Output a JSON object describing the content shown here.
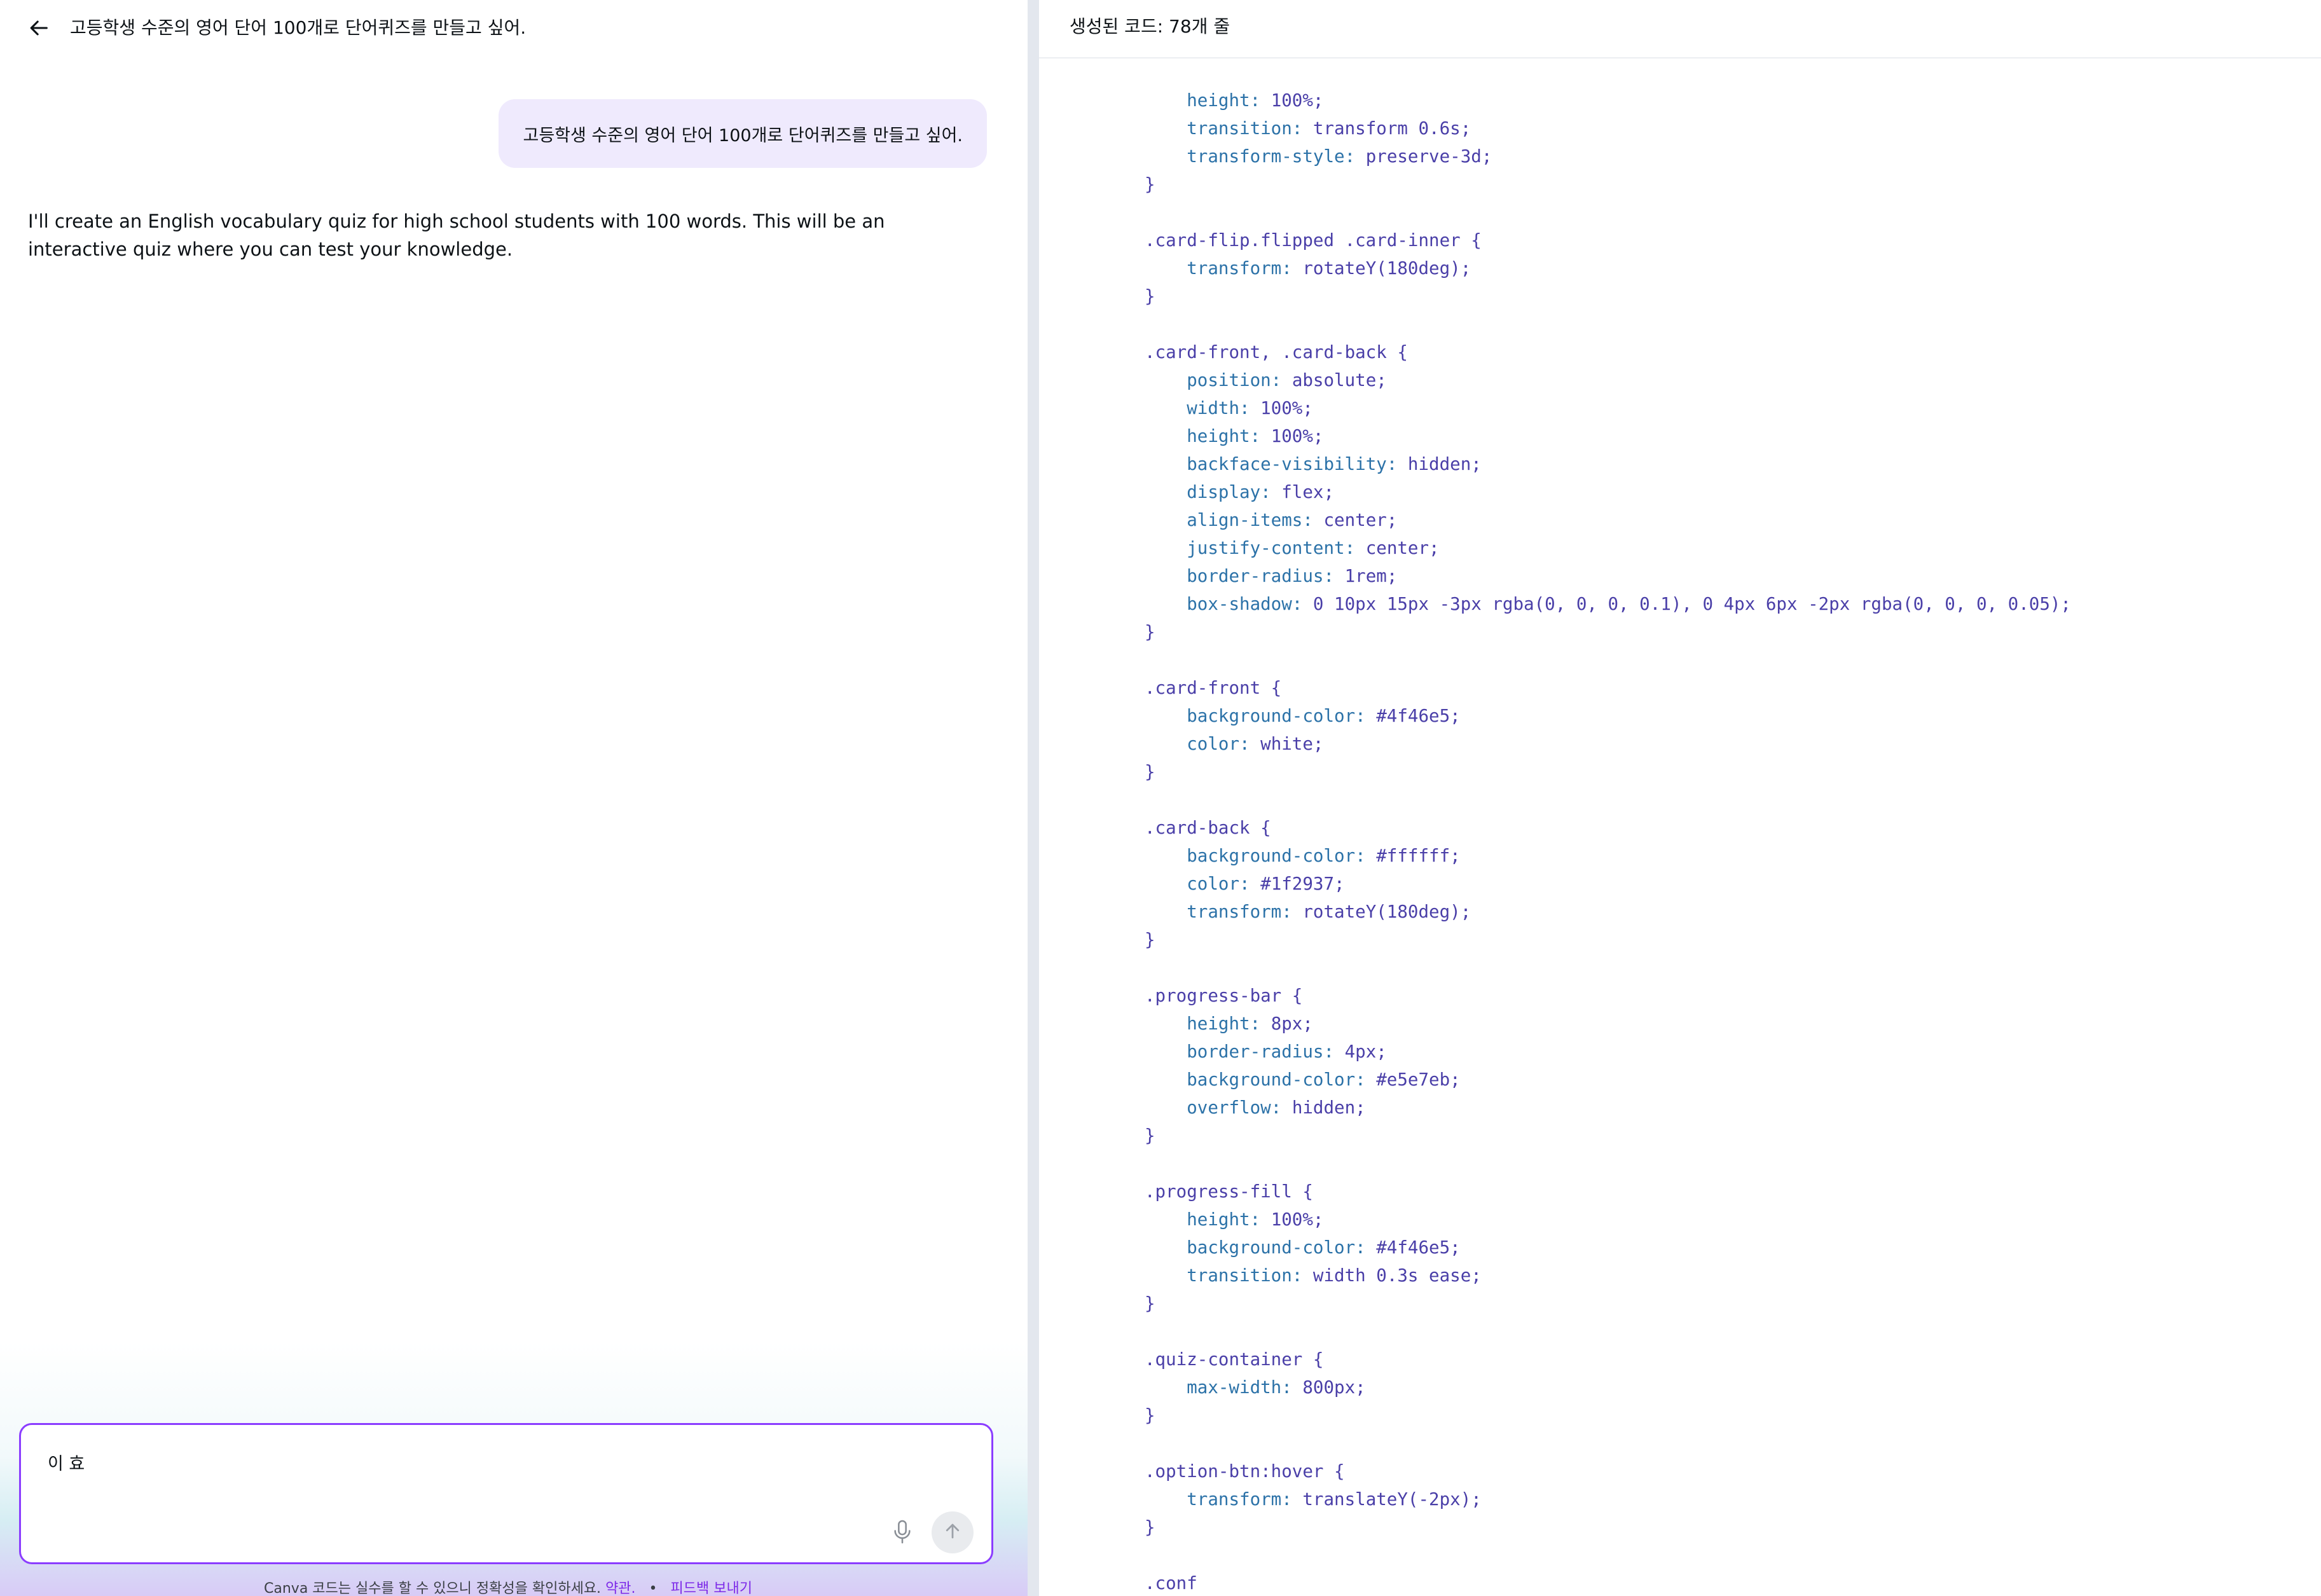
{
  "chat": {
    "title": "고등학생 수준의 영어 단어 100개로 단어퀴즈를 만들고 싶어.",
    "user_message": "고등학생 수준의 영어 단어 100개로 단어퀴즈를 만들고 싶어.",
    "assistant_message": "I'll create an English vocabulary quiz for high school students with 100 words. This will be an interactive quiz where you can test your knowledge.",
    "composer_value": "이 효",
    "icons": {
      "back": "arrow-left-icon",
      "mic": "microphone-icon",
      "send": "arrow-up-icon"
    },
    "footer": {
      "note": "Canva 코드는 실수를 할 수 있으니 정확성을 확인하세요.",
      "terms_link": "약관.",
      "separator": "•",
      "feedback_link": "피드백 보내기"
    },
    "colors": {
      "accent": "#8b3dff",
      "user_bubble": "#efeafd",
      "link": "#7d2ae8"
    }
  },
  "code_panel": {
    "header": "생성된 코드: 78개 줄",
    "lines": [
      "    height: 100%;",
      "    transition: transform 0.6s;",
      "    transform-style: preserve-3d;",
      "}",
      "",
      ".card-flip.flipped .card-inner {",
      "    transform: rotateY(180deg);",
      "}",
      "",
      ".card-front, .card-back {",
      "    position: absolute;",
      "    width: 100%;",
      "    height: 100%;",
      "    backface-visibility: hidden;",
      "    display: flex;",
      "    align-items: center;",
      "    justify-content: center;",
      "    border-radius: 1rem;",
      "    box-shadow: 0 10px 15px -3px rgba(0, 0, 0, 0.1), 0 4px 6px -2px rgba(0, 0, 0, 0.05);",
      "}",
      "",
      ".card-front {",
      "    background-color: #4f46e5;",
      "    color: white;",
      "}",
      "",
      ".card-back {",
      "    background-color: #ffffff;",
      "    color: #1f2937;",
      "    transform: rotateY(180deg);",
      "}",
      "",
      ".progress-bar {",
      "    height: 8px;",
      "    border-radius: 4px;",
      "    background-color: #e5e7eb;",
      "    overflow: hidden;",
      "}",
      "",
      ".progress-fill {",
      "    height: 100%;",
      "    background-color: #4f46e5;",
      "    transition: width 0.3s ease;",
      "}",
      "",
      ".quiz-container {",
      "    max-width: 800px;",
      "}",
      "",
      ".option-btn:hover {",
      "    transform: translateY(-2px);",
      "}",
      "",
      ".conf"
    ]
  }
}
